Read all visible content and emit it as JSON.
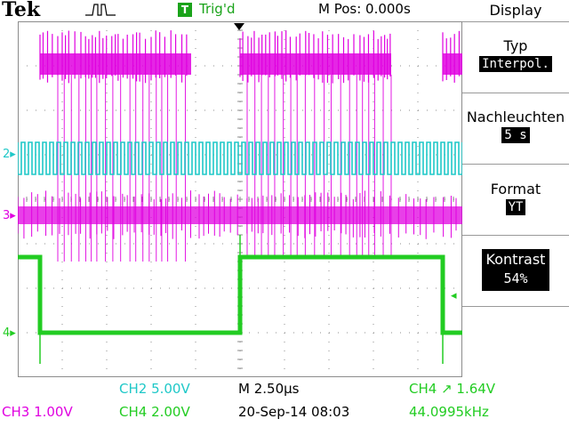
{
  "header": {
    "brand": "Tek",
    "trigger_badge": "T",
    "trigger_status": "Trig'd",
    "position": "M Pos: 0.000s"
  },
  "menu": {
    "title": "Display",
    "items": [
      {
        "label": "Typ",
        "value": "Interpol."
      },
      {
        "label": "Nachleuchten",
        "value": "5 s"
      },
      {
        "label": "Format",
        "value": "YT"
      },
      {
        "label": "Kontrast",
        "value": "54%",
        "selected": true
      }
    ]
  },
  "channels": {
    "ch2_marker": "2",
    "ch3_marker": "3",
    "ch4_marker": "4"
  },
  "status": {
    "ch2": "CH2  5.00V",
    "ch3": "CH3  1.00V",
    "ch4": "CH4  2.00V",
    "timebase": "M 2.50µs",
    "date": "20-Sep-14 08:03",
    "trigger": "CH4 ↗ 1.64V",
    "frequency": "44.0995kHz"
  },
  "colors": {
    "ch2": "#1fc8c8",
    "ch3": "#e000e0",
    "ch4": "#22cc22",
    "grid": "#8c8c8c",
    "trigger_badge": "#1aa31a"
  }
}
